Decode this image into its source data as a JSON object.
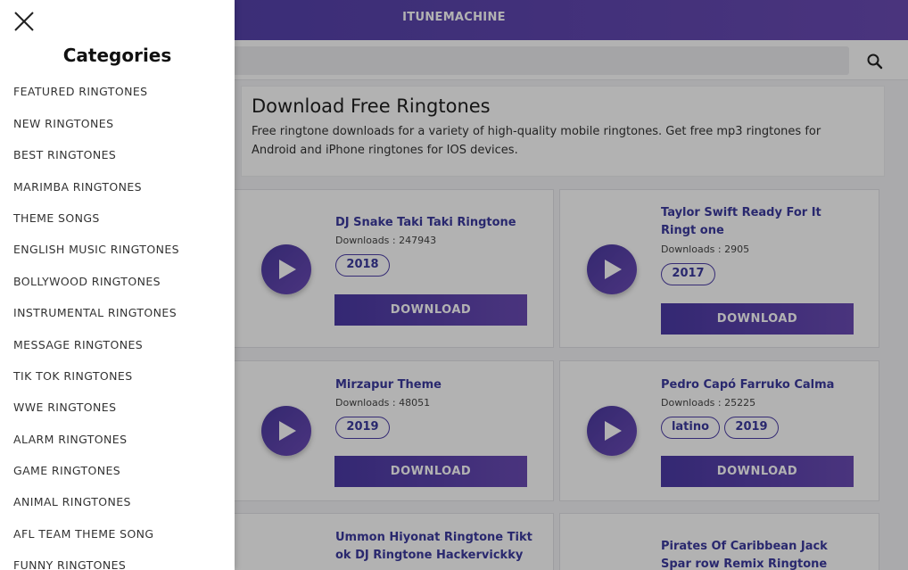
{
  "header": {
    "brand": "ITUNEMACHINE"
  },
  "search": {
    "value": "",
    "placeholder": ""
  },
  "intro": {
    "title": "Download Free Ringtones",
    "text": "Free ringtone downloads for a variety of high-quality mobile ringtones. Get free mp3 ringtones for Android and iPhone ringtones for IOS devices."
  },
  "cards": [
    {
      "title": "DJ Snake Taki Taki Ringtone",
      "downloads": "Downloads : 247943",
      "tags": [
        "2018"
      ],
      "button": "DOWNLOAD"
    },
    {
      "title": "Taylor Swift Ready For It Ringt one",
      "downloads": "Downloads : 2905",
      "tags": [
        "2017"
      ],
      "button": "DOWNLOAD"
    },
    {
      "title": "Mirzapur Theme",
      "downloads": "Downloads : 48051",
      "tags": [
        "2019"
      ],
      "button": "DOWNLOAD"
    },
    {
      "title": "Pedro Capó Farruko Calma",
      "downloads": "Downloads : 25225",
      "tags": [
        "latino",
        "2019"
      ],
      "button": "DOWNLOAD"
    },
    {
      "title": "Ummon Hiyonat Ringtone Tikt ok DJ Ringtone Hackervickky",
      "downloads": "",
      "tags": [],
      "button": ""
    },
    {
      "title": "Pirates Of Caribbean Jack Spar row Remix Ringtone",
      "downloads": "",
      "tags": [],
      "button": ""
    }
  ],
  "drawer": {
    "title": "Categories",
    "items": [
      "FEATURED RINGTONES",
      "NEW RINGTONES",
      "BEST RINGTONES",
      "MARIMBA RINGTONES",
      "THEME SONGS",
      "ENGLISH MUSIC RINGTONES",
      "BOLLYWOOD RINGTONES",
      "INSTRUMENTAL RINGTONES",
      "MESSAGE RINGTONES",
      "TIK TOK RINGTONES",
      "WWE RINGTONES",
      "ALARM RINGTONES",
      "GAME RINGTONES",
      "ANIMAL RINGTONES",
      "AFL TEAM THEME SONG",
      "FUNNY RINGTONES"
    ]
  },
  "icons": {
    "close": "close-icon",
    "search": "search-icon",
    "play": "play-icon"
  },
  "colors": {
    "brand": "#4e3fa8",
    "brand_end": "#6a4bb4",
    "title": "#3b3a9e"
  }
}
